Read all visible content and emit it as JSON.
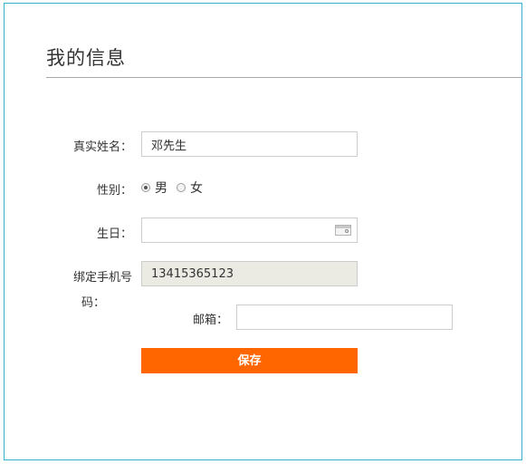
{
  "page": {
    "title": "我的信息"
  },
  "form": {
    "name": {
      "label": "真实姓名：",
      "value": "邓先生"
    },
    "gender": {
      "label": "性别：",
      "options": [
        "男",
        "女"
      ],
      "selected": "男"
    },
    "birthday": {
      "label": "生日：",
      "value": ""
    },
    "phone": {
      "label_line1": "绑定手机号",
      "label_line2": "码：",
      "value": "13415365123"
    },
    "email": {
      "label": "邮箱：",
      "value": ""
    },
    "save_label": "保存"
  },
  "colors": {
    "accent": "#ff6600",
    "frame_border": "#3aaed0"
  }
}
